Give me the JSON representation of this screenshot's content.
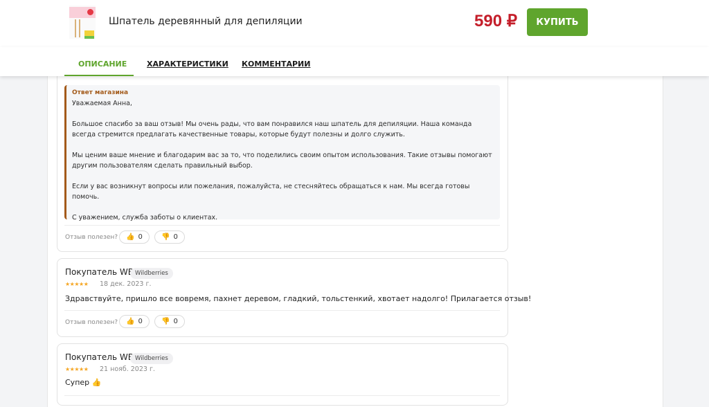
{
  "header": {
    "product_name": "Шпатель деревянный для депиляции",
    "price": "590 ₽",
    "buy_label": "КУПИТЬ"
  },
  "tabs": [
    {
      "label": "ОПИСАНИЕ",
      "active": true
    },
    {
      "label": "ХАРАКТЕРИСТИКИ",
      "active": false
    },
    {
      "label": "КОММЕНТАРИИ",
      "active": false
    }
  ],
  "store_reply": {
    "label": "Ответ магазина",
    "paragraphs": [
      "Уважаемая Анна,",
      "Большое спасибо за ваш отзыв! Мы очень рады, что вам понравился наш шпатель для депиляции. Наша команда всегда стремится предлагать качественные товары, которые будут полезны и долго служить.",
      "Мы ценим ваше мнение и благодарим вас за то, что поделились своим опытом использования. Такие отзывы помогают другим пользователям сделать правильный выбор.",
      "Если у вас возникнут вопросы или пожелания, пожалуйста, не стесняйтесь обращаться к нам. Мы всегда готовы помочь.",
      "С уважением, служба заботы о клиентах."
    ]
  },
  "helpful_label": "Отзыв полезен?",
  "votes_first": {
    "up": "0",
    "down": "0"
  },
  "reviews": [
    {
      "author": "Покупатель WB",
      "badge": "Wildberries",
      "stars": "★★★★★",
      "date": "18 дек. 2023 г.",
      "text": "Здравствуйте, пришло все вовремя, пахнет деревом, гладкий, тольстенкий, хвотает надолго! Прилагается отзыв!",
      "votes": {
        "up": "0",
        "down": "0"
      }
    },
    {
      "author": "Покупатель WB",
      "badge": "Wildberries",
      "stars": "★★★★★",
      "date": "21 нояб. 2023 г.",
      "text": "Супер 👍"
    }
  ],
  "icons": {
    "thumbs_up": "👍",
    "thumbs_down": "👎"
  },
  "colors": {
    "accent_green": "#5fa52d",
    "price_red": "#c41e2a",
    "reply_brown": "#a35a1a",
    "star_gold": "#f5a623"
  }
}
